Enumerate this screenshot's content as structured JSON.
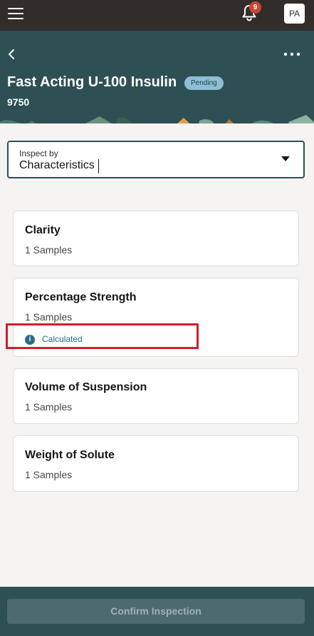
{
  "topbar": {
    "menu_icon": "hamburger-menu-icon",
    "notifications_icon": "bell-icon",
    "notification_count": "9",
    "user_initials": "PA"
  },
  "header": {
    "back_icon": "chevron-left-icon",
    "more_icon": "more-horizontal-icon",
    "title": "Fast Acting U-100 Insulin",
    "status": "Pending",
    "subtitle": "9750"
  },
  "inspect_by": {
    "label": "Inspect by",
    "value": "Characteristics",
    "dropdown_icon": "caret-down-icon"
  },
  "characteristics": [
    {
      "name": "Clarity",
      "samples": "1 Samples"
    },
    {
      "name": "Percentage Strength",
      "samples": "1 Samples",
      "info": "Calculated",
      "info_icon": "info-icon"
    },
    {
      "name": "Volume of Suspension",
      "samples": "1 Samples"
    },
    {
      "name": "Weight of Solute",
      "samples": "1 Samples"
    }
  ],
  "footer": {
    "confirm_label": "Confirm Inspection"
  },
  "colors": {
    "topbar": "#312d2a",
    "header": "#2e5054",
    "status_pill": "#8fbfd6",
    "badge": "#c74634",
    "highlight": "#d01e2d",
    "info": "#2d6b87"
  }
}
